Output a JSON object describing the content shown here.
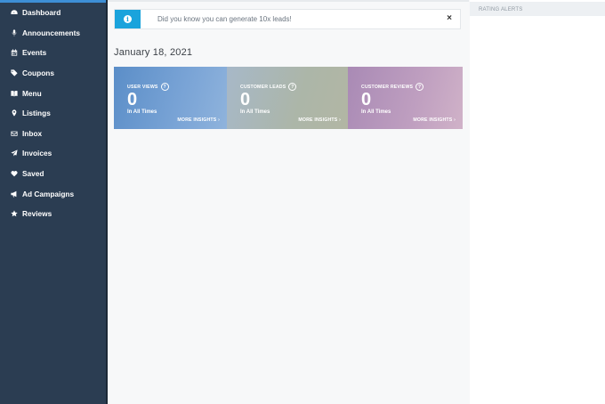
{
  "sidebar": {
    "items": [
      {
        "label": "Dashboard",
        "icon": "dashboard-icon"
      },
      {
        "label": "Announcements",
        "icon": "microphone-icon"
      },
      {
        "label": "Events",
        "icon": "calendar-icon"
      },
      {
        "label": "Coupons",
        "icon": "tag-icon"
      },
      {
        "label": "Menu",
        "icon": "book-icon"
      },
      {
        "label": "Listings",
        "icon": "map-pin-icon"
      },
      {
        "label": "Inbox",
        "icon": "envelope-icon"
      },
      {
        "label": "Invoices",
        "icon": "paper-plane-icon"
      },
      {
        "label": "Saved",
        "icon": "heart-icon"
      },
      {
        "label": "Ad Campaigns",
        "icon": "bullhorn-icon"
      },
      {
        "label": "Reviews",
        "icon": "star-icon"
      }
    ]
  },
  "alert": {
    "text": "Did you know you can generate 10x leads!",
    "close": "×",
    "icon": "info-icon",
    "icon_glyph": "i"
  },
  "main": {
    "date": "January 18, 2021"
  },
  "cards": [
    {
      "label": "USER VIEWS",
      "value": "0",
      "sub": "In All Times",
      "more": "MORE INSIGHTS  ›"
    },
    {
      "label": "CUSTOMER LEADS",
      "value": "0",
      "sub": "In All Times",
      "more": "MORE INSIGHTS  ›"
    },
    {
      "label": "CUSTOMER REVIEWS",
      "value": "0",
      "sub": "In All Times",
      "more": "MORE INSIGHTS  ›"
    }
  ],
  "card_help_glyph": "?",
  "right_panel": {
    "title": "RATING ALERTS"
  },
  "colors": {
    "sidebar_bg": "#2b3d52",
    "accent": "#1aa3dc"
  }
}
